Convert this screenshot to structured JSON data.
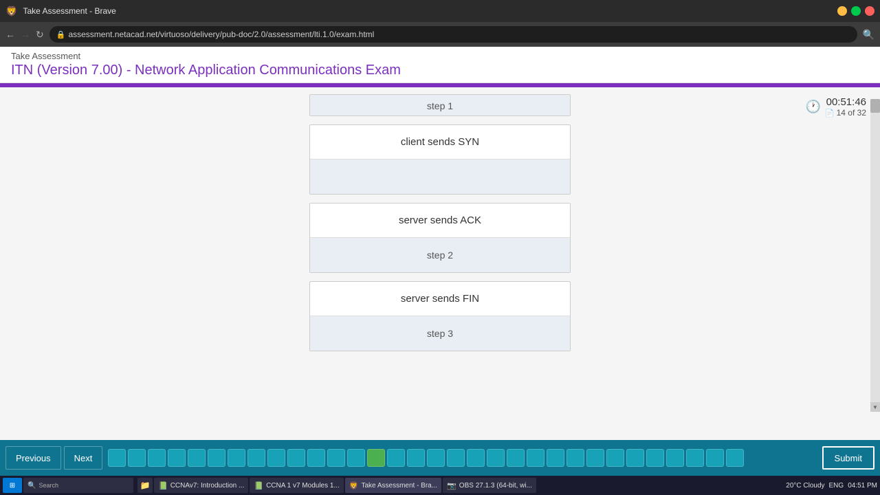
{
  "browser": {
    "title": "Take Assessment - Brave",
    "address": "assessment.netacad.net/virtuoso/delivery/pub-doc/2.0/assessment/lti.1.0/exam.html"
  },
  "page": {
    "header_label": "Take Assessment",
    "exam_title": "ITN (Version 7.00) - Network Application Communications Exam",
    "timer": "00:51:46",
    "question_count": "14 of 32"
  },
  "cards": [
    {
      "id": "card-partial",
      "top_text": "",
      "bottom_text": "step 1",
      "partial": true
    },
    {
      "id": "card-client-syn",
      "top_text": "client sends SYN",
      "bottom_text": "",
      "has_empty_bottom": true
    },
    {
      "id": "card-server-ack",
      "top_text": "server sends ACK",
      "bottom_text": "step 2"
    },
    {
      "id": "card-server-fin",
      "top_text": "server sends FIN",
      "bottom_text": "step 3"
    }
  ],
  "navigation": {
    "previous_label": "Previous",
    "next_label": "Next",
    "submit_label": "Submit",
    "total_questions": 32,
    "current_question": 14,
    "active_dot_index": 13
  },
  "taskbar": {
    "temperature": "20°C Cloudy",
    "language": "ENG",
    "time": "04:51 PM",
    "items": [
      "CCNAv7: Introduction ...",
      "CCNA 1 v7 Modules 1...",
      "Take Assessment - Bra...",
      "OBS 27.1.3 (64-bit, wi..."
    ]
  }
}
